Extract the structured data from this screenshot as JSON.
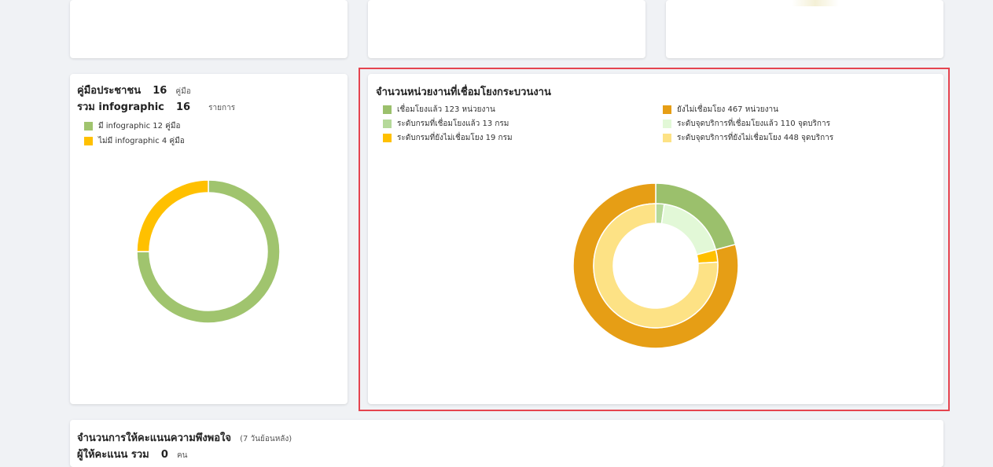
{
  "top_cards": [
    {},
    {},
    {}
  ],
  "left_card": {
    "line1_label": "คู่มือประชาชน",
    "line1_value": "16",
    "line1_unit": "คู่มือ",
    "line2_label": "รวม infographic",
    "line2_value": "16",
    "line2_unit": "รายการ",
    "legend": [
      {
        "label": "มี infographic 12 คู่มือ",
        "color": "#a0c46e"
      },
      {
        "label": "ไม่มี infographic 4 คู่มือ",
        "color": "#ffc000"
      }
    ]
  },
  "right_card": {
    "title": "จำนวนหน่วยงานที่เชื่อมโยงกระบวนงาน",
    "legend_left": [
      {
        "label": "เชื่อมโยงแล้ว 123 หน่วยงาน",
        "color": "#9bc06c"
      },
      {
        "label": "ระดับกรมที่เชื่อมโยงแล้ว 13 กรม",
        "color": "#b5d99a"
      },
      {
        "label": "ระดับกรมที่ยังไม่เชื่อมโยง 19 กรม",
        "color": "#ffc000"
      }
    ],
    "legend_right": [
      {
        "label": "ยังไม่เชื่อมโยง 467 หน่วยงาน",
        "color": "#e69e15"
      },
      {
        "label": "ระดับจุดบริการที่เชื่อมโยงแล้ว 110 จุดบริการ",
        "color": "#e2f8d7"
      },
      {
        "label": "ระดับจุดบริการที่ยังไม่เชื่อมโยง 448 จุดบริการ",
        "color": "#fde285"
      }
    ]
  },
  "bottom_card": {
    "title": "จำนวนการให้คะแนนความพึงพอใจ",
    "title_note": "(7 วันย้อนหลัง)",
    "line2_label": "ผู้ให้คะแนน รวม",
    "line2_value": "0",
    "line2_unit": "คน"
  },
  "chart_data": [
    {
      "type": "pie",
      "categories": [
        "มี infographic 12 คู่มือ",
        "ไม่มี infographic 4 คู่มือ"
      ],
      "values": [
        12,
        4
      ],
      "colors": [
        "#a0c46e",
        "#ffc000"
      ]
    },
    {
      "type": "pie",
      "series": [
        {
          "categories": [
            "เชื่อมโยงแล้ว 123 หน่วยงาน",
            "ยังไม่เชื่อมโยง 467 หน่วยงาน"
          ],
          "values": [
            123,
            467
          ],
          "colors": [
            "#9bc06c",
            "#e69e15"
          ]
        },
        {
          "categories": [
            "ระดับกรมที่เชื่อมโยงแล้ว 13 กรม",
            "ระดับจุดบริการที่เชื่อมโยงแล้ว 110 จุดบริการ",
            "ระดับกรมที่ยังไม่เชื่อมโยง 19 กรม",
            "ระดับจุดบริการที่ยังไม่เชื่อมโยง 448 จุดบริการ"
          ],
          "values": [
            13,
            110,
            19,
            448
          ],
          "colors": [
            "#b5d99a",
            "#e2f8d7",
            "#ffc000",
            "#fde285"
          ]
        }
      ]
    }
  ]
}
